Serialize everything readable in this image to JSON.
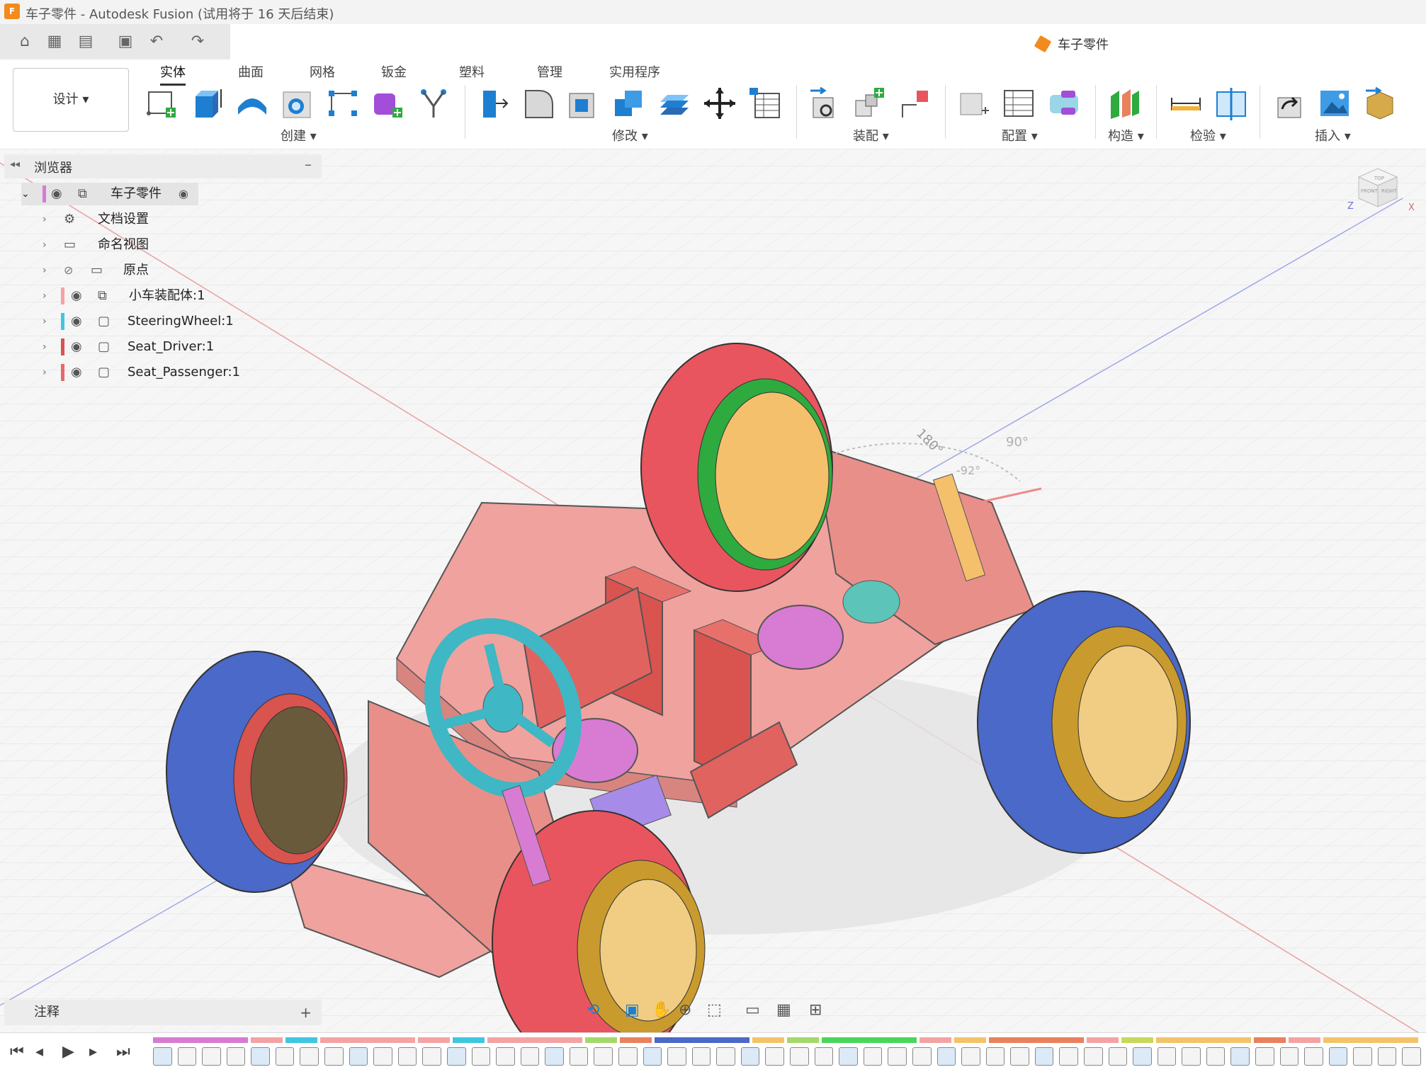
{
  "window": {
    "title": "车子零件 - Autodesk Fusion (试用将于 16 天后结束)",
    "logo_text": "F"
  },
  "document": {
    "tab_title": "车子零件"
  },
  "workspace": {
    "label": "设计 ▾"
  },
  "ribbon": {
    "tabs": [
      "实体",
      "曲面",
      "网格",
      "钣金",
      "塑料",
      "管理",
      "实用程序"
    ],
    "groups": [
      "创建 ▾",
      "修改 ▾",
      "装配 ▾",
      "配置 ▾",
      "构造 ▾",
      "检验 ▾",
      "插入 ▾"
    ]
  },
  "browser": {
    "title": "浏览器",
    "root": "车子零件",
    "items": [
      "文档设置",
      "命名视图",
      "原点",
      "小车装配体:1",
      "SteeringWheel:1",
      "Seat_Driver:1",
      "Seat_Passenger:1"
    ]
  },
  "viewcube": {
    "top": "TOP",
    "front": "FRONT",
    "right": "RIGHT",
    "z_axis": "Z",
    "x_axis": "X"
  },
  "angle_labels": [
    "180°",
    "90°",
    "-92°"
  ],
  "notes": {
    "label": "注释",
    "add": "+"
  },
  "colors": {
    "accent": "#f28a1c",
    "selection": "#0696d7",
    "wheel_red": "#e9555e",
    "wheel_blue": "#4a69c8",
    "chassis": "#ef9d9a"
  }
}
